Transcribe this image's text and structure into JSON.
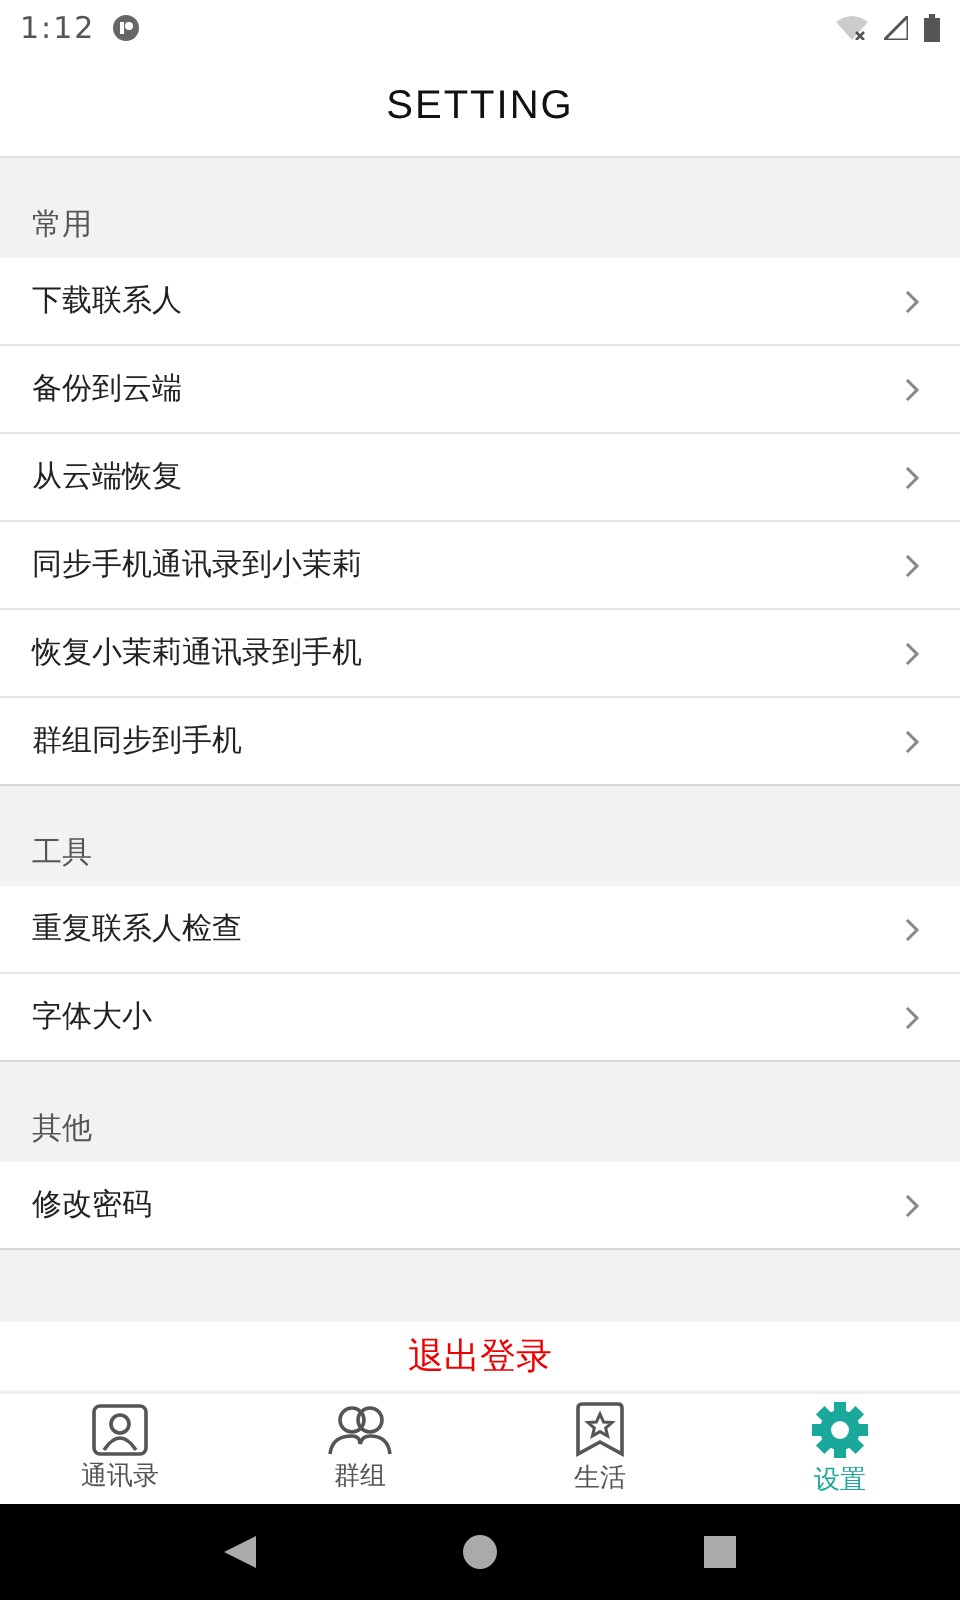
{
  "status_bar": {
    "time": "1:12"
  },
  "header": {
    "title": "SETTING"
  },
  "sections": [
    {
      "title": "常用",
      "items": [
        {
          "label": "下载联系人"
        },
        {
          "label": "备份到云端"
        },
        {
          "label": "从云端恢复"
        },
        {
          "label": "同步手机通讯录到小茉莉"
        },
        {
          "label": "恢复小茉莉通讯录到手机"
        },
        {
          "label": "群组同步到手机"
        }
      ]
    },
    {
      "title": "工具",
      "items": [
        {
          "label": "重复联系人检查"
        },
        {
          "label": "字体大小"
        }
      ]
    },
    {
      "title": "其他",
      "items": [
        {
          "label": "修改密码"
        }
      ]
    }
  ],
  "logout_button": "退出登录",
  "tabs": [
    {
      "label": "通讯录",
      "kind": "contacts",
      "selected": false
    },
    {
      "label": "群组",
      "kind": "group",
      "selected": false
    },
    {
      "label": "生活",
      "kind": "life",
      "selected": false
    },
    {
      "label": "设置",
      "kind": "settings",
      "selected": true
    }
  ]
}
